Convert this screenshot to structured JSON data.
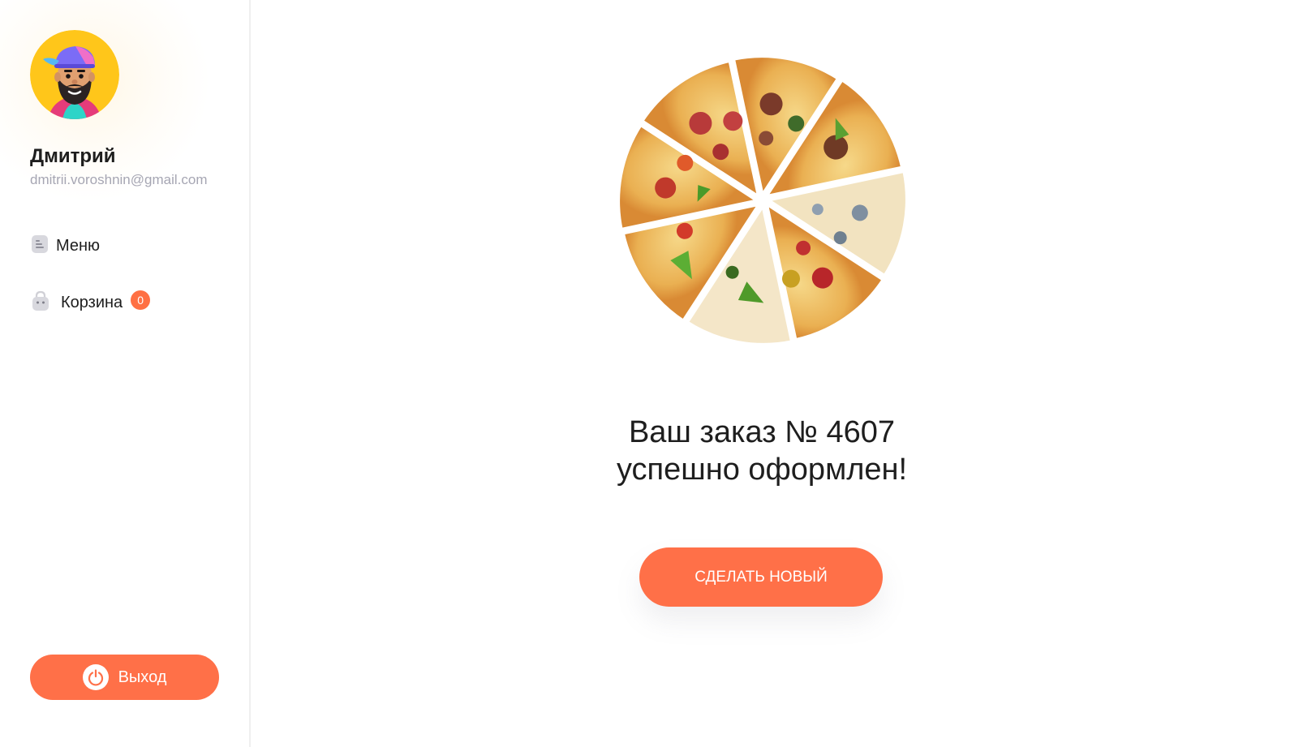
{
  "user": {
    "name": "Дмитрий",
    "email": "dmitrii.voroshnin@gmail.com"
  },
  "nav": {
    "menu_label": "Меню",
    "cart_label": "Корзина",
    "cart_count": "0"
  },
  "logout": {
    "label": "Выход"
  },
  "order": {
    "message_line1": "Ваш заказ № 4607",
    "message_line2": "успешно оформлен!",
    "new_order_label": "СДЕЛАТЬ НОВЫЙ"
  },
  "icons": {
    "menu": "menu-list-icon",
    "cart": "shopping-bag-icon",
    "logout": "power-icon"
  },
  "colors": {
    "accent": "#ff7048",
    "badge": "#ff7043",
    "email": "#a6a6b3",
    "text": "#1e1e1e"
  }
}
